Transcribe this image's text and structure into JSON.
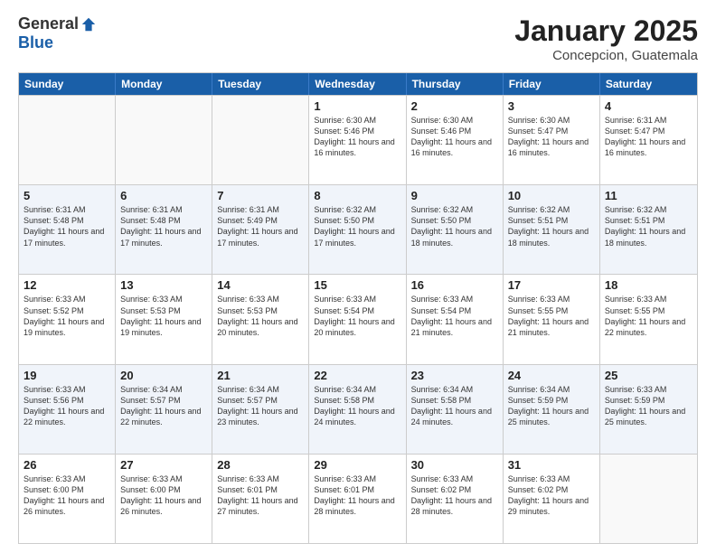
{
  "header": {
    "logo_general": "General",
    "logo_blue": "Blue",
    "title": "January 2025",
    "subtitle": "Concepcion, Guatemala"
  },
  "weekdays": [
    "Sunday",
    "Monday",
    "Tuesday",
    "Wednesday",
    "Thursday",
    "Friday",
    "Saturday"
  ],
  "rows": [
    [
      {
        "day": "",
        "info": ""
      },
      {
        "day": "",
        "info": ""
      },
      {
        "day": "",
        "info": ""
      },
      {
        "day": "1",
        "info": "Sunrise: 6:30 AM\nSunset: 5:46 PM\nDaylight: 11 hours and 16 minutes."
      },
      {
        "day": "2",
        "info": "Sunrise: 6:30 AM\nSunset: 5:46 PM\nDaylight: 11 hours and 16 minutes."
      },
      {
        "day": "3",
        "info": "Sunrise: 6:30 AM\nSunset: 5:47 PM\nDaylight: 11 hours and 16 minutes."
      },
      {
        "day": "4",
        "info": "Sunrise: 6:31 AM\nSunset: 5:47 PM\nDaylight: 11 hours and 16 minutes."
      }
    ],
    [
      {
        "day": "5",
        "info": "Sunrise: 6:31 AM\nSunset: 5:48 PM\nDaylight: 11 hours and 17 minutes."
      },
      {
        "day": "6",
        "info": "Sunrise: 6:31 AM\nSunset: 5:48 PM\nDaylight: 11 hours and 17 minutes."
      },
      {
        "day": "7",
        "info": "Sunrise: 6:31 AM\nSunset: 5:49 PM\nDaylight: 11 hours and 17 minutes."
      },
      {
        "day": "8",
        "info": "Sunrise: 6:32 AM\nSunset: 5:50 PM\nDaylight: 11 hours and 17 minutes."
      },
      {
        "day": "9",
        "info": "Sunrise: 6:32 AM\nSunset: 5:50 PM\nDaylight: 11 hours and 18 minutes."
      },
      {
        "day": "10",
        "info": "Sunrise: 6:32 AM\nSunset: 5:51 PM\nDaylight: 11 hours and 18 minutes."
      },
      {
        "day": "11",
        "info": "Sunrise: 6:32 AM\nSunset: 5:51 PM\nDaylight: 11 hours and 18 minutes."
      }
    ],
    [
      {
        "day": "12",
        "info": "Sunrise: 6:33 AM\nSunset: 5:52 PM\nDaylight: 11 hours and 19 minutes."
      },
      {
        "day": "13",
        "info": "Sunrise: 6:33 AM\nSunset: 5:53 PM\nDaylight: 11 hours and 19 minutes."
      },
      {
        "day": "14",
        "info": "Sunrise: 6:33 AM\nSunset: 5:53 PM\nDaylight: 11 hours and 20 minutes."
      },
      {
        "day": "15",
        "info": "Sunrise: 6:33 AM\nSunset: 5:54 PM\nDaylight: 11 hours and 20 minutes."
      },
      {
        "day": "16",
        "info": "Sunrise: 6:33 AM\nSunset: 5:54 PM\nDaylight: 11 hours and 21 minutes."
      },
      {
        "day": "17",
        "info": "Sunrise: 6:33 AM\nSunset: 5:55 PM\nDaylight: 11 hours and 21 minutes."
      },
      {
        "day": "18",
        "info": "Sunrise: 6:33 AM\nSunset: 5:55 PM\nDaylight: 11 hours and 22 minutes."
      }
    ],
    [
      {
        "day": "19",
        "info": "Sunrise: 6:33 AM\nSunset: 5:56 PM\nDaylight: 11 hours and 22 minutes."
      },
      {
        "day": "20",
        "info": "Sunrise: 6:34 AM\nSunset: 5:57 PM\nDaylight: 11 hours and 22 minutes."
      },
      {
        "day": "21",
        "info": "Sunrise: 6:34 AM\nSunset: 5:57 PM\nDaylight: 11 hours and 23 minutes."
      },
      {
        "day": "22",
        "info": "Sunrise: 6:34 AM\nSunset: 5:58 PM\nDaylight: 11 hours and 24 minutes."
      },
      {
        "day": "23",
        "info": "Sunrise: 6:34 AM\nSunset: 5:58 PM\nDaylight: 11 hours and 24 minutes."
      },
      {
        "day": "24",
        "info": "Sunrise: 6:34 AM\nSunset: 5:59 PM\nDaylight: 11 hours and 25 minutes."
      },
      {
        "day": "25",
        "info": "Sunrise: 6:33 AM\nSunset: 5:59 PM\nDaylight: 11 hours and 25 minutes."
      }
    ],
    [
      {
        "day": "26",
        "info": "Sunrise: 6:33 AM\nSunset: 6:00 PM\nDaylight: 11 hours and 26 minutes."
      },
      {
        "day": "27",
        "info": "Sunrise: 6:33 AM\nSunset: 6:00 PM\nDaylight: 11 hours and 26 minutes."
      },
      {
        "day": "28",
        "info": "Sunrise: 6:33 AM\nSunset: 6:01 PM\nDaylight: 11 hours and 27 minutes."
      },
      {
        "day": "29",
        "info": "Sunrise: 6:33 AM\nSunset: 6:01 PM\nDaylight: 11 hours and 28 minutes."
      },
      {
        "day": "30",
        "info": "Sunrise: 6:33 AM\nSunset: 6:02 PM\nDaylight: 11 hours and 28 minutes."
      },
      {
        "day": "31",
        "info": "Sunrise: 6:33 AM\nSunset: 6:02 PM\nDaylight: 11 hours and 29 minutes."
      },
      {
        "day": "",
        "info": ""
      }
    ]
  ]
}
